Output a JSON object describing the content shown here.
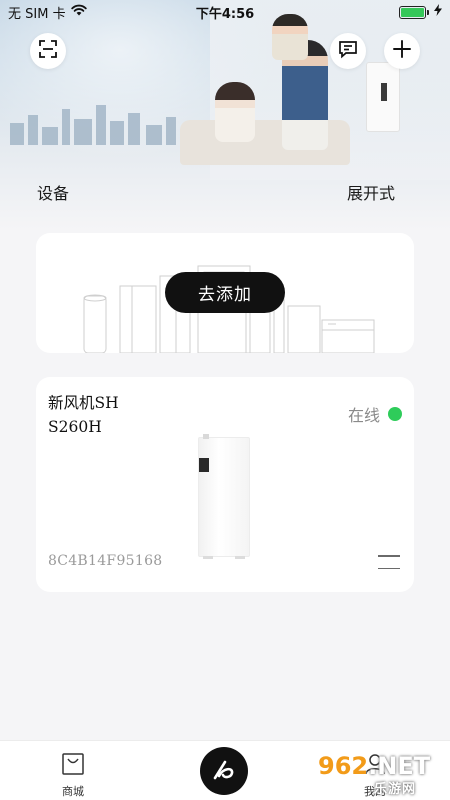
{
  "status_bar": {
    "carrier": "无 SIM 卡",
    "time": "下午4:56",
    "icons": [
      "wifi-icon",
      "battery-icon",
      "charging-icon"
    ],
    "battery_color": "#35c759"
  },
  "header": {
    "left_icon": "scan-icon",
    "right_icons": [
      "message-icon",
      "plus-icon"
    ]
  },
  "section": {
    "title": "设备",
    "view_mode": "展开式"
  },
  "add_card": {
    "button_label": "去添加"
  },
  "device": {
    "name_line1": "新风机SH",
    "name_line2": "S260H",
    "status": "在线",
    "status_color": "#2ecc5a",
    "mac": "8C4B14F95168",
    "menu_icon": "menu-icon"
  },
  "tab_bar": {
    "left_label": "商城",
    "left_icon": "shopping-bag-icon",
    "center_icon": "brand-logo-icon",
    "right_label": "我的"
  },
  "watermark": {
    "brand": "962",
    "suffix": ".NET",
    "subtitle": "乐游网"
  }
}
